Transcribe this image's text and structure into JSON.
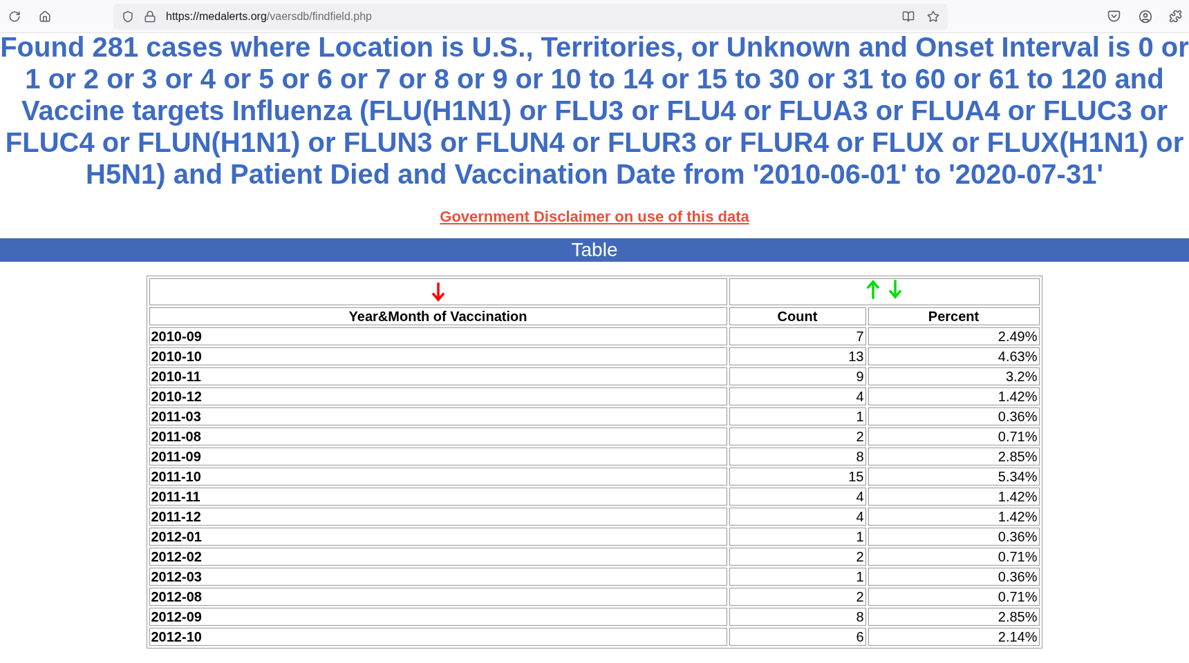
{
  "browser": {
    "url_host": "https://medalerts.org",
    "url_path": "/vaersdb/findfield.php"
  },
  "heading": "Found 281 cases where Location is U.S., Territories, or Unknown and Onset Interval is 0 or 1 or 2 or 3 or 4 or 5 or 6 or 7 or 8 or 9 or 10 to 14 or 15 to 30 or 31 to 60 or 61 to 120 and Vaccine targets Influenza (FLU(H1N1) or FLU3 or FLU4 or FLUA3 or FLUA4 or FLUC3 or FLUC4 or FLUN(H1N1) or FLUN3 or FLUN4 or FLUR3 or FLUR4 or FLUX or FLUX(H1N1) or H5N1) and Patient Died and Vaccination Date from '2010-06-01' to '2020-07-31'",
  "disclaimer_link": "Government Disclaimer on use of this data",
  "section_bar": "Table",
  "table": {
    "columns": [
      "Year&Month of Vaccination",
      "Count",
      "Percent"
    ],
    "rows": [
      {
        "month": "2010-09",
        "count": "7",
        "percent": "2.49%"
      },
      {
        "month": "2010-10",
        "count": "13",
        "percent": "4.63%"
      },
      {
        "month": "2010-11",
        "count": "9",
        "percent": "3.2%"
      },
      {
        "month": "2010-12",
        "count": "4",
        "percent": "1.42%"
      },
      {
        "month": "2011-03",
        "count": "1",
        "percent": "0.36%"
      },
      {
        "month": "2011-08",
        "count": "2",
        "percent": "0.71%"
      },
      {
        "month": "2011-09",
        "count": "8",
        "percent": "2.85%"
      },
      {
        "month": "2011-10",
        "count": "15",
        "percent": "5.34%"
      },
      {
        "month": "2011-11",
        "count": "4",
        "percent": "1.42%"
      },
      {
        "month": "2011-12",
        "count": "4",
        "percent": "1.42%"
      },
      {
        "month": "2012-01",
        "count": "1",
        "percent": "0.36%"
      },
      {
        "month": "2012-02",
        "count": "2",
        "percent": "0.71%"
      },
      {
        "month": "2012-03",
        "count": "1",
        "percent": "0.36%"
      },
      {
        "month": "2012-08",
        "count": "2",
        "percent": "0.71%"
      },
      {
        "month": "2012-09",
        "count": "8",
        "percent": "2.85%"
      },
      {
        "month": "2012-10",
        "count": "6",
        "percent": "2.14%"
      }
    ]
  }
}
